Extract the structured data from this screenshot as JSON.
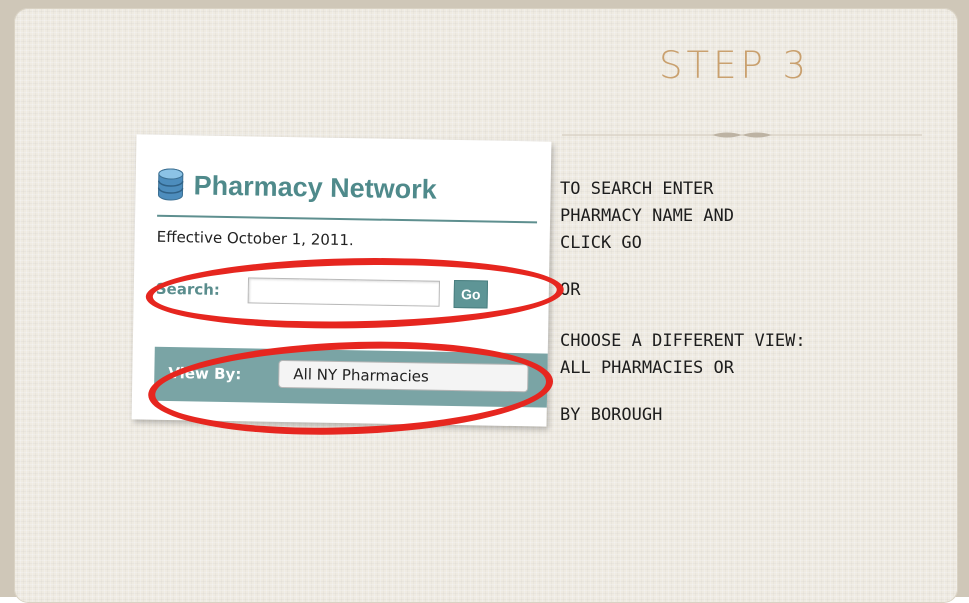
{
  "slide": {
    "title": "STEP 3",
    "instructions": {
      "search": [
        "TO SEARCH ENTER",
        "PHARMACY NAME AND",
        "CLICK GO"
      ],
      "or": "OR",
      "view": [
        "CHOOSE A DIFFERENT VIEW:",
        "ALL PHARMACIES OR"
      ],
      "borough": "BY BOROUGH"
    }
  },
  "screenshot": {
    "header": "Pharmacy Network",
    "effective": "Effective October 1, 2011.",
    "search_label": "Search:",
    "search_value": "",
    "go_button": "Go",
    "viewby_label": "View By:",
    "viewby_selected": "All NY Pharmacies",
    "icon": "database-icon"
  },
  "colors": {
    "accent_title": "#c9a06e",
    "teal": "#4f8a8b",
    "highlight_red": "#e6261f"
  }
}
